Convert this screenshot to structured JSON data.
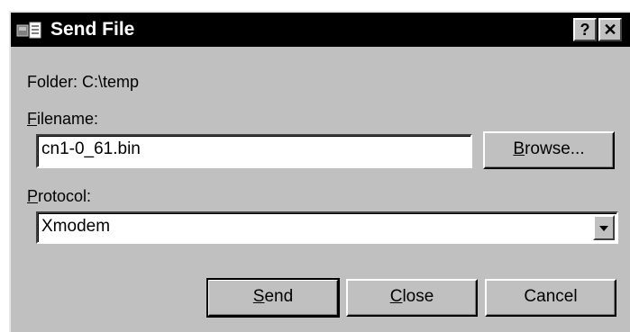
{
  "window": {
    "title": "Send File",
    "help_label": "?",
    "close_label": "✕"
  },
  "folder": {
    "label": "Folder:",
    "value": "C:\\temp"
  },
  "filename": {
    "label_mnemonic": "F",
    "label_rest": "ilename:",
    "value": "cn1-0_61.bin"
  },
  "browse": {
    "mnemonic": "B",
    "rest": "rowse..."
  },
  "protocol": {
    "label_mnemonic": "P",
    "label_rest": "rotocol:",
    "selected": "Xmodem"
  },
  "buttons": {
    "send": {
      "mnemonic": "S",
      "rest": "end"
    },
    "close": {
      "mnemonic": "C",
      "rest": "lose"
    },
    "cancel": {
      "label": "Cancel"
    }
  },
  "colors": {
    "dialog_face": "#c0c0c0",
    "titlebar": "#000000",
    "title_text": "#ffffff",
    "field_background": "#ffffff"
  },
  "icons": {
    "title": "send-file-icon",
    "dropdown": "chevron-down-icon"
  }
}
